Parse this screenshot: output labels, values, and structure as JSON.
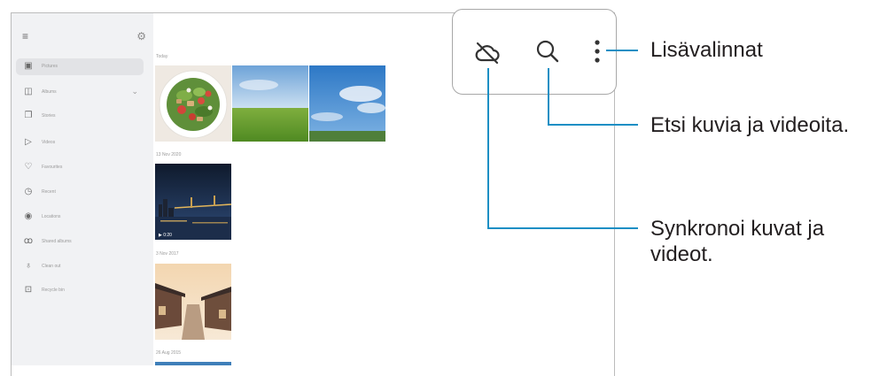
{
  "sidebar": {
    "items": [
      {
        "label": "Pictures",
        "icon": "picture-icon",
        "glyph": "▣",
        "selected": true
      },
      {
        "label": "Albums",
        "icon": "album-icon",
        "glyph": "◫",
        "chevron": "⌄"
      },
      {
        "label": "Stories",
        "icon": "story-icon",
        "glyph": "❐"
      },
      {
        "label": "Videos",
        "icon": "video-icon",
        "glyph": "▷"
      },
      {
        "label": "Favourites",
        "icon": "heart-icon",
        "glyph": "♡"
      },
      {
        "label": "Recent",
        "icon": "clock-icon",
        "glyph": "◷"
      },
      {
        "label": "Locations",
        "icon": "location-icon",
        "glyph": "◉"
      },
      {
        "label": "Shared albums",
        "icon": "people-icon",
        "glyph": "ꝏ"
      },
      {
        "label": "Clean out",
        "icon": "broom-icon",
        "glyph": "♁"
      },
      {
        "label": "Recycle bin",
        "icon": "trash-icon",
        "glyph": "⊡"
      }
    ]
  },
  "gallery": {
    "sections": [
      {
        "date": "Today"
      },
      {
        "date": "13 Nov 2020"
      },
      {
        "date": "3 Nov 2017"
      },
      {
        "date": "26 Aug 2015"
      }
    ],
    "video_overlay": "▶ 0:20"
  },
  "toolbar": {
    "icons": [
      "cloud-sync-off-icon",
      "search-icon",
      "more-options-icon"
    ]
  },
  "annotations": {
    "more_options": "Lisävalinnat",
    "search": "Etsi kuvia ja videoita.",
    "sync_line1": "Synkronoi kuvat ja",
    "sync_line2": "videot."
  },
  "colors": {
    "leader": "#1a8fc4",
    "sidebar_bg": "#f1f2f4",
    "selected_bg": "#e2e3e6"
  }
}
